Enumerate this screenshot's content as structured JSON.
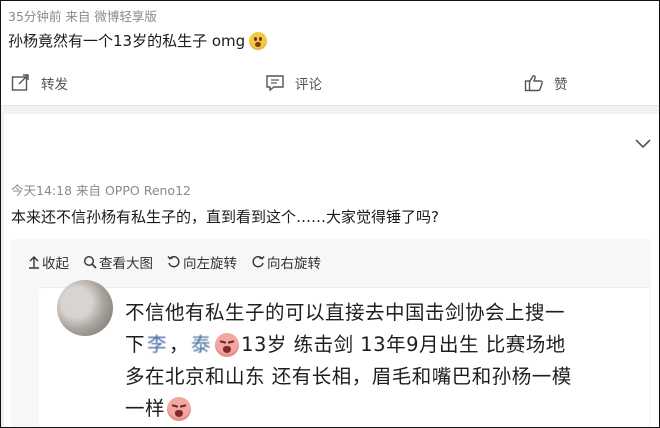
{
  "post1": {
    "meta": "35分钟前  来自 微博轻享版",
    "text": "孙杨竟然有一个13岁的私生子 omg",
    "emoji_icon": "shocked-face-emoji",
    "actions": {
      "repost": "转发",
      "comment": "评论",
      "like": "赞"
    }
  },
  "post2": {
    "meta": "今天14:18  来自 OPPO Reno12",
    "text": "本来还不信孙杨有私生子的，直到看到这个……大家觉得锤了吗?",
    "toolbar": {
      "collapse": "收起",
      "view_large": "查看大图",
      "rotate_left": "向左旋转",
      "rotate_right": "向右旋转"
    },
    "card": {
      "line1": "不信他有私生子的可以直接去中国击剑协会上搜一",
      "line2_pre": "下 ",
      "name_a": "李",
      "name_sep": "，",
      "name_b": "泰",
      "line2_post": "13岁 练击剑 13年9月出生 比赛场地",
      "line3": "多在北京和山东 还有长相，眉毛和嘴巴和孙杨一模",
      "line4": "一样"
    }
  },
  "colors": {
    "meta_gray": "#8a8a8a",
    "icon_gray": "#555555",
    "link_blue": "#4a6fa0"
  }
}
